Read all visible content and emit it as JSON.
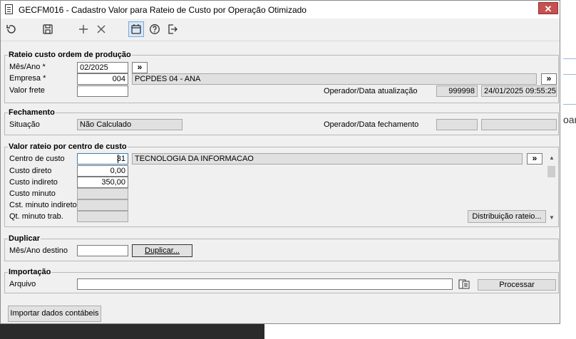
{
  "window": {
    "title": "GECFM016 - Cadastro Valor para Rateio de Custo por Operação Otimizado",
    "close_label": "✕"
  },
  "toolbar": {
    "icons": [
      "refresh-icon",
      "save-icon",
      "add-icon",
      "delete-icon",
      "calendar-icon",
      "help-icon",
      "exit-icon"
    ]
  },
  "rateio_op": {
    "title": "Rateio custo ordem de produção",
    "mes_ano_label": "Mês/Ano *",
    "mes_ano_value": "02/2025",
    "empresa_label": "Empresa *",
    "empresa_code": "004",
    "empresa_name": "PCPDES 04 - ANA",
    "valor_frete_label": "Valor frete",
    "valor_frete_value": "",
    "operador_label": "Operador/Data atualização",
    "operador_value": "999998",
    "data_value": "24/01/2025 09:55:25",
    "arrow_label": "»"
  },
  "fechamento": {
    "title": "Fechamento",
    "situacao_label": "Situação",
    "situacao_value": "Não Calculado",
    "operador_label": "Operador/Data fechamento",
    "operador_value": "",
    "data_value": ""
  },
  "valor_rateio": {
    "title": "Valor rateio por centro de custo",
    "centro_label": "Centro de custo",
    "centro_code": "31",
    "centro_name": "TECNOLOGIA DA INFORMACAO",
    "custo_direto_label": "Custo direto",
    "custo_direto_value": "0,00",
    "custo_indireto_label": "Custo indireto",
    "custo_indireto_value": "350,00",
    "custo_minuto_label": "Custo minuto",
    "cst_minuto_label": "Cst. minuto indireto",
    "qt_minuto_label": "Qt. minuto trab.",
    "distribuicao_label": "Distribuição rateio..."
  },
  "duplicar": {
    "title": "Duplicar",
    "mes_ano_label": "Mês/Ano destino",
    "mes_ano_value": "",
    "button_label": "Duplicar..."
  },
  "importacao": {
    "title": "Importação",
    "arquivo_label": "Arquivo",
    "arquivo_value": "",
    "processar_label": "Processar"
  },
  "footer": {
    "importar_label": "Importar dados contábeis"
  },
  "background": {
    "partial_text": "oara"
  }
}
